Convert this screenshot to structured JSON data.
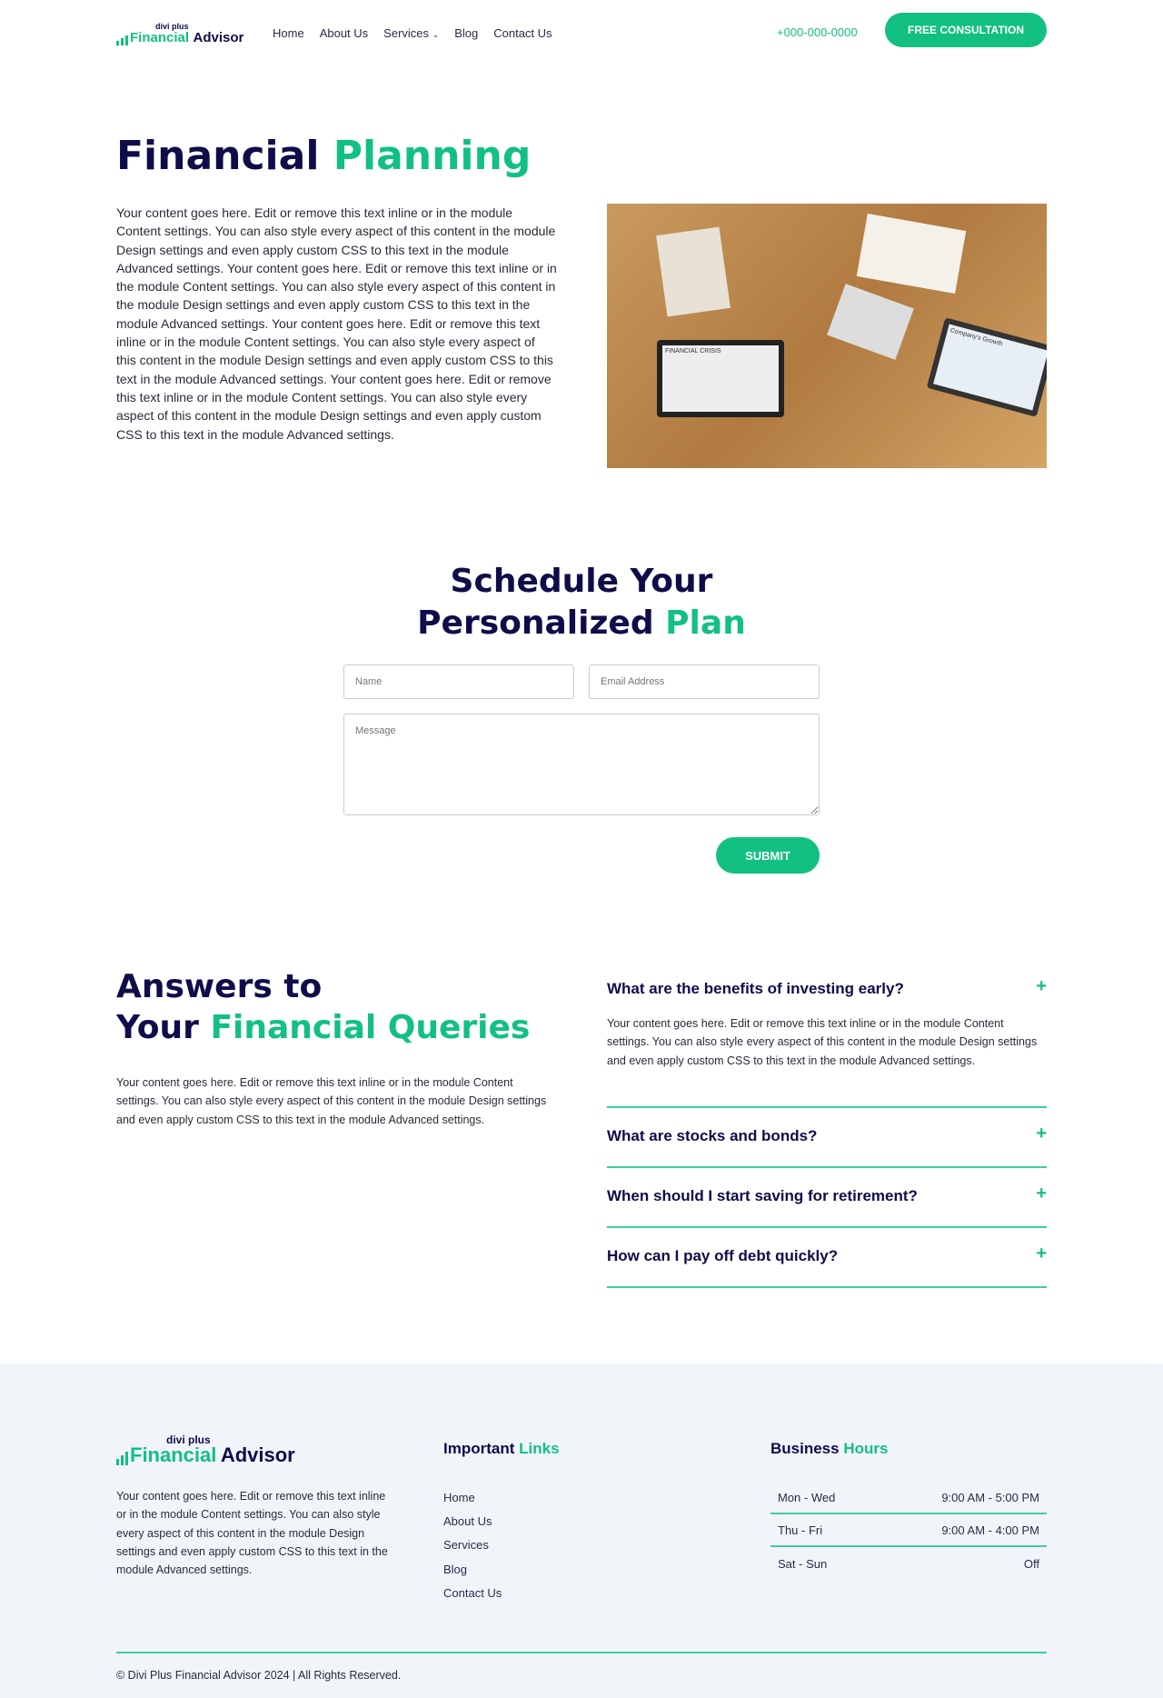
{
  "header": {
    "logo_small": "divi plus",
    "logo_green": "Financial",
    "logo_navy": "Advisor",
    "nav": [
      "Home",
      "About Us",
      "Services",
      "Blog",
      "Contact Us"
    ],
    "phone": "+000-000-0000",
    "cta": "FREE CONSULTATION"
  },
  "hero": {
    "title_navy": "Financial",
    "title_green": "Planning",
    "body": "Your content goes here. Edit or remove this text inline or in the module Content settings. You can also style every aspect of this content in the module Design settings and even apply custom CSS to this text in the module Advanced settings. Your content goes here. Edit or remove this text inline or in the module Content settings. You can also style every aspect of this content in the module Design settings and even apply custom CSS to this text in the module Advanced settings. Your content goes here. Edit or remove this text inline or in the module Content settings. You can also style every aspect of this content in the module Design settings and even apply custom CSS to this text in the module Advanced settings. Your content goes here. Edit or remove this text inline or in the module Content settings. You can also style every aspect of this content in the module Design settings and even apply custom CSS to this text in the module Advanced settings.",
    "image_labels": [
      "FINANCIAL CRISIS",
      "Company's Growth"
    ]
  },
  "schedule": {
    "title_line1": "Schedule Your",
    "title_navy": "Personalized",
    "title_green": "Plan",
    "name_placeholder": "Name",
    "email_placeholder": "Email Address",
    "message_placeholder": "Message",
    "submit": "SUBMIT"
  },
  "faq": {
    "title_line1": "Answers to",
    "title_navy": "Your",
    "title_green": "Financial Queries",
    "body": "Your content goes here. Edit or remove this text inline or in the module Content settings. You can also style every aspect of this content in the module Design settings and even apply custom CSS to this text in the module Advanced settings.",
    "items": [
      {
        "q": "What are the benefits of investing early?",
        "a": "Your content goes here. Edit or remove this text inline or in the module Content settings. You can also style every aspect of this content in the module Design settings and even apply custom CSS to this text in the module Advanced settings."
      },
      {
        "q": "What are stocks and bonds?"
      },
      {
        "q": "When should I start saving for retirement?"
      },
      {
        "q": "How can I pay off debt quickly?"
      }
    ]
  },
  "footer": {
    "about": "Your content goes here. Edit or remove this text inline or in the module Content settings. You can also style every aspect of this content in the module Design settings and even apply custom CSS to this text in the module Advanced settings.",
    "links_navy": "Important",
    "links_green": "Links",
    "links": [
      "Home",
      "About Us",
      "Services",
      "Blog",
      "Contact Us"
    ],
    "hours_navy": "Business",
    "hours_green": "Hours",
    "hours": [
      {
        "day": "Mon - Wed",
        "time": "9:00 AM - 5:00 PM"
      },
      {
        "day": "Thu - Fri",
        "time": "9:00 AM - 4:00 PM"
      },
      {
        "day": "Sat - Sun",
        "time": "Off"
      }
    ],
    "copyright": "© Divi Plus Financial Advisor 2024 | All Rights Reserved."
  },
  "colors": {
    "accent": "#12c082",
    "navy": "#0f0c4a",
    "footer_bg": "#f1f5fa"
  }
}
